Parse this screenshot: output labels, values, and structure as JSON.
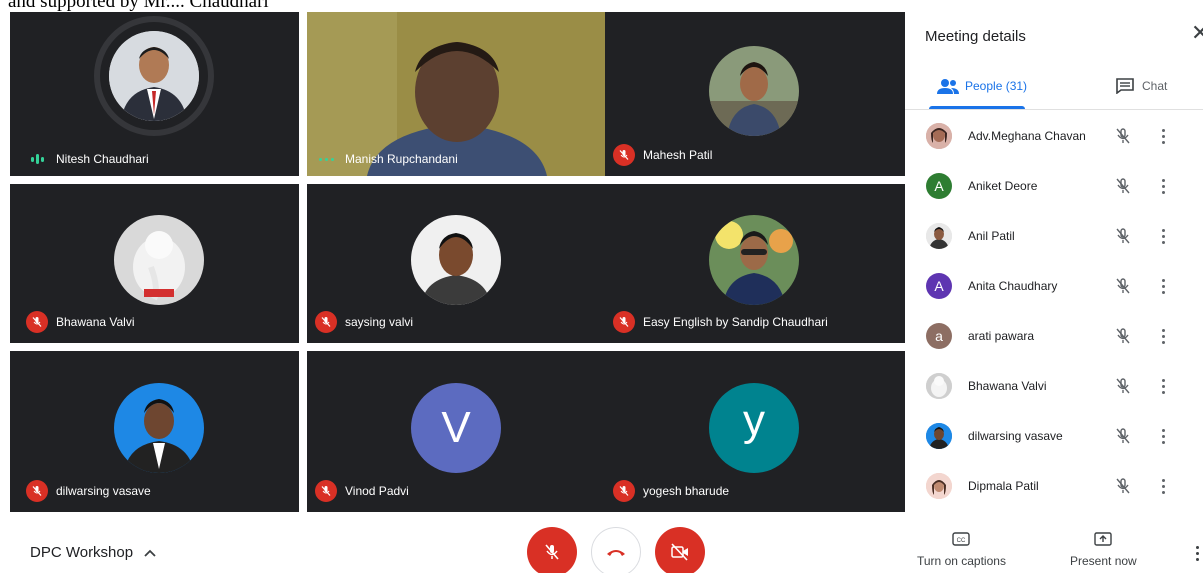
{
  "top_caption": "and supported by Mr.... Chaudhari",
  "participants": [
    {
      "name": "Nitesh Chaudhari"
    },
    {
      "name": "Manish Rupchandani"
    },
    {
      "name": "Mahesh Patil"
    },
    {
      "name": "Bhawana Valvi"
    },
    {
      "name": "saysing valvi"
    },
    {
      "name": "Easy English by Sandip Chaudhari"
    },
    {
      "name": "dilwarsing vasave"
    },
    {
      "name": "Vinod Padvi",
      "initial": "V"
    },
    {
      "name": "yogesh bharude",
      "initial": "y"
    }
  ],
  "panel": {
    "title": "Meeting details",
    "tabs": {
      "people": "People (31)",
      "chat": "Chat"
    },
    "people": [
      {
        "name": "Adv.Meghana Chavan"
      },
      {
        "name": "Aniket Deore",
        "initial": "A"
      },
      {
        "name": "Anil Patil"
      },
      {
        "name": "Anita Chaudhary",
        "initial": "A"
      },
      {
        "name": "arati pawara",
        "initial": "a"
      },
      {
        "name": "Bhawana Valvi"
      },
      {
        "name": "dilwarsing vasave"
      },
      {
        "name": "Dipmala Patil"
      }
    ]
  },
  "bottom": {
    "meeting_name": "DPC Workshop",
    "captions_label": "Turn on captions",
    "present_label": "Present now"
  },
  "colors": {
    "tile": "#202124",
    "mute": "#d93025",
    "accent": "#1a73e8"
  }
}
